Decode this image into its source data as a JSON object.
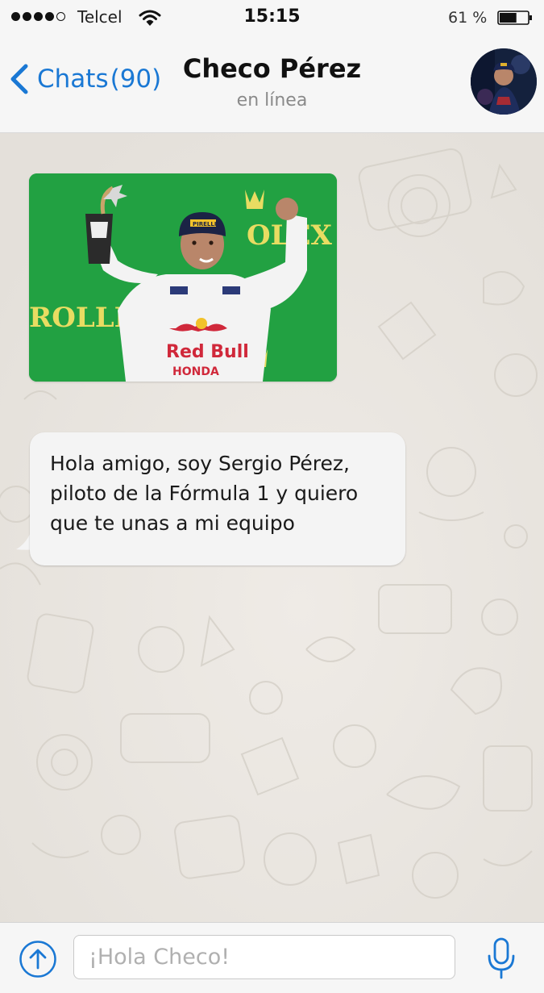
{
  "status_bar": {
    "carrier": "Telcel",
    "time": "15:15",
    "battery_percent": "61 %",
    "signal_bars_filled": 4,
    "signal_bars_total": 5,
    "battery_level": 0.61,
    "icons": [
      "signal-dots-icon",
      "wifi-icon",
      "battery-icon"
    ]
  },
  "header": {
    "back_label": "Chats",
    "unread_count": "(90)",
    "contact_name": "Checo Pérez",
    "contact_status": "en línea",
    "avatar_icon": "contact-avatar"
  },
  "messages": [
    {
      "type": "image",
      "sender": "contact",
      "image_text": {
        "sponsor_top": "OLEX",
        "sponsor_left": "ROLLE",
        "shirt_brand": "Red Bull",
        "shirt_sub": "HONDA",
        "cap": "PIRELLI"
      }
    },
    {
      "type": "text",
      "sender": "contact",
      "text": "Hola amigo, soy Sergio Pérez,\npiloto de la Fórmula 1 y quiero\nque te unas a mi equipo"
    }
  ],
  "input_bar": {
    "placeholder": "¡Hola Checo!",
    "attach_icon": "upload-arrow-icon",
    "mic_icon": "microphone-icon"
  },
  "colors": {
    "accent": "#1a78d4",
    "bar_background": "#f6f6f6",
    "chat_background": "#e9e5df",
    "bubble": "#f4f4f4",
    "photo_green": "#1f9a3e"
  }
}
